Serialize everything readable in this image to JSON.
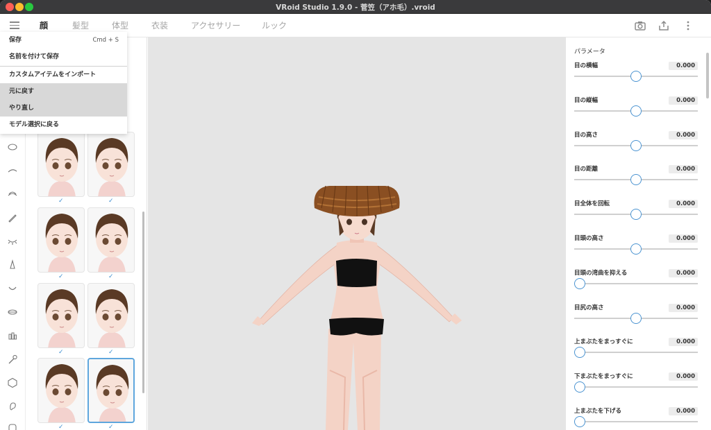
{
  "window": {
    "title": "VRoid Studio 1.9.0 - 菅笠（アホ毛）.vroid"
  },
  "tabs": [
    {
      "label": "顔",
      "active": true
    },
    {
      "label": "髪型",
      "active": false
    },
    {
      "label": "体型",
      "active": false
    },
    {
      "label": "衣装",
      "active": false
    },
    {
      "label": "アクセサリー",
      "active": false
    },
    {
      "label": "ルック",
      "active": false
    }
  ],
  "toolbar_icons": [
    "camera-icon",
    "share-icon",
    "more-vertical-icon"
  ],
  "menu": {
    "items": [
      {
        "label": "保存",
        "shortcut": "Cmd + S",
        "shaded": false
      },
      {
        "label": "名前を付けて保存",
        "shaded": false
      },
      {
        "label": "カスタムアイテムをインポート",
        "shaded": false
      },
      {
        "label": "元に戻す",
        "shaded": true
      },
      {
        "label": "やり直し",
        "shaded": true
      },
      {
        "label": "モデル選択に戻る",
        "shaded": false
      }
    ]
  },
  "rail_icons": [
    "face-outline-icon",
    "eyebrow-icon",
    "eyelash-icon",
    "eyeliner-brush-icon",
    "lower-lash-icon",
    "nose-icon",
    "mouth-icon",
    "lips-icon",
    "teeth-icon",
    "makeup-brush-icon",
    "head-shape-icon",
    "ear-icon",
    "face-detail-icon"
  ],
  "presets": [
    {
      "check": "✓",
      "selected": false
    },
    {
      "check": "✓",
      "selected": false
    },
    {
      "check": "✓",
      "selected": false
    },
    {
      "check": "✓",
      "selected": false
    },
    {
      "check": "✓",
      "selected": false
    },
    {
      "check": "✓",
      "selected": false
    },
    {
      "check": "✓",
      "selected": false
    },
    {
      "check": "✓",
      "selected": true
    }
  ],
  "panel": {
    "title": "パラメータ",
    "params": [
      {
        "label": "目の横幅",
        "value": "0.000",
        "level": 0.5
      },
      {
        "label": "目の縦幅",
        "value": "0.000",
        "level": 0.5
      },
      {
        "label": "目の高さ",
        "value": "0.000",
        "level": 0.5
      },
      {
        "label": "目の距離",
        "value": "0.000",
        "level": 0.5
      },
      {
        "label": "目全体を回転",
        "value": "0.000",
        "level": 0.5
      },
      {
        "label": "目頭の高さ",
        "value": "0.000",
        "level": 0.5
      },
      {
        "label": "目頭の湾曲を抑える",
        "value": "0.000",
        "level": 0
      },
      {
        "label": "目尻の高さ",
        "value": "0.000",
        "level": 0.5
      },
      {
        "label": "上まぶたをまっすぐに",
        "value": "0.000",
        "level": 0
      },
      {
        "label": "下まぶたをまっすぐに",
        "value": "0.000",
        "level": 0
      },
      {
        "label": "上まぶたを下げる",
        "value": "0.000",
        "level": 0
      }
    ]
  },
  "colors": {
    "accent": "#4a93d1",
    "viewport_bg": "#e5e5e5",
    "hat": "#8a4f22",
    "hair": "#5a3a25",
    "skin": "#f4d3c6"
  }
}
